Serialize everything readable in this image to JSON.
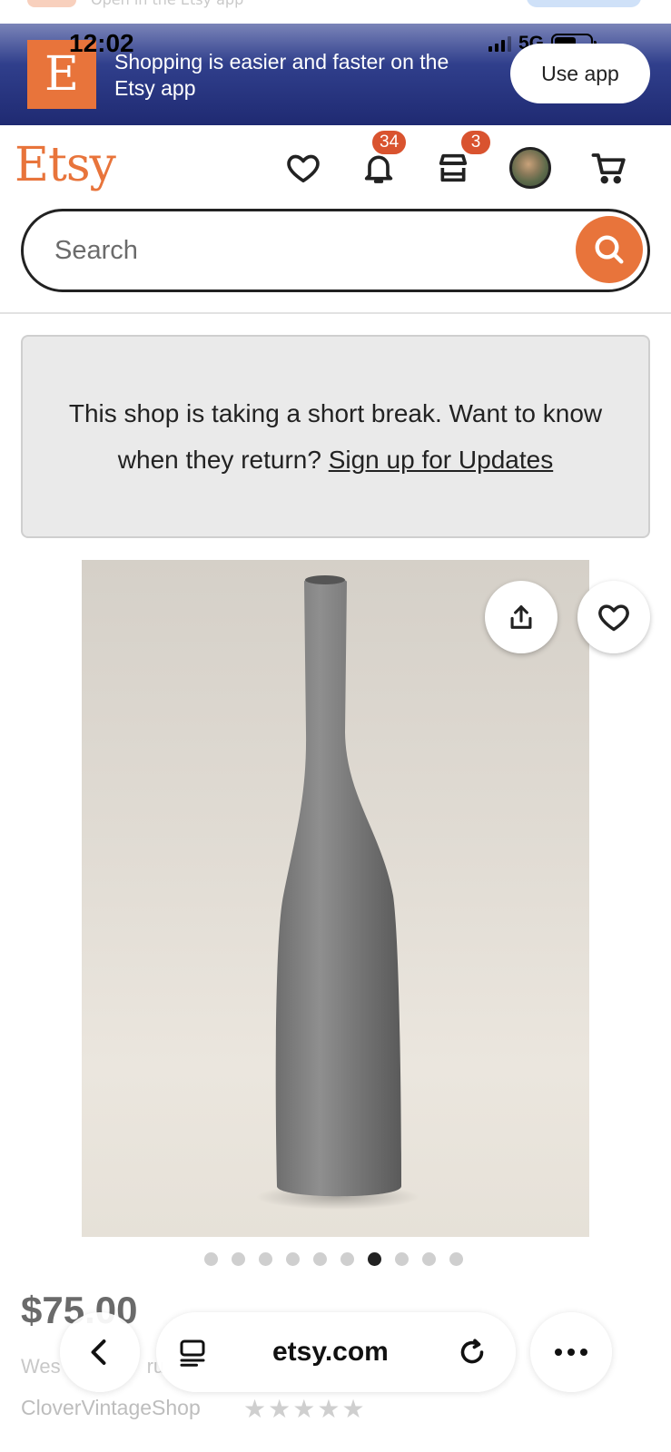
{
  "status_bar": {
    "time": "12:02",
    "network": "5G"
  },
  "top_sliver": {
    "text": "Open in the Etsy app"
  },
  "app_banner": {
    "logo_letter": "E",
    "text": "Shopping is easier and faster on the Etsy app",
    "button": "Use app"
  },
  "header": {
    "logo": "Etsy",
    "notifications_count": "34",
    "shop_manager_count": "3"
  },
  "search": {
    "placeholder": "Search"
  },
  "notice": {
    "text": "This shop is taking a short break. Want to know when they return?",
    "link": "Sign up for Updates"
  },
  "gallery": {
    "total_images": 10,
    "active_index": 6
  },
  "listing": {
    "price": "$75.00",
    "title_fragment": "Wes",
    "title_fragment_2": "ru",
    "shop_name": "CloverVintageShop",
    "rating_stars": 5
  },
  "browser": {
    "url": "etsy.com"
  },
  "colors": {
    "accent": "#e8743b",
    "banner": "#243078",
    "badge": "#d9532f"
  },
  "icons": [
    "heart-icon",
    "bell-icon",
    "shop-icon",
    "cart-icon",
    "search-icon",
    "share-icon",
    "back-icon",
    "reader-icon",
    "reload-icon",
    "more-icon"
  ]
}
